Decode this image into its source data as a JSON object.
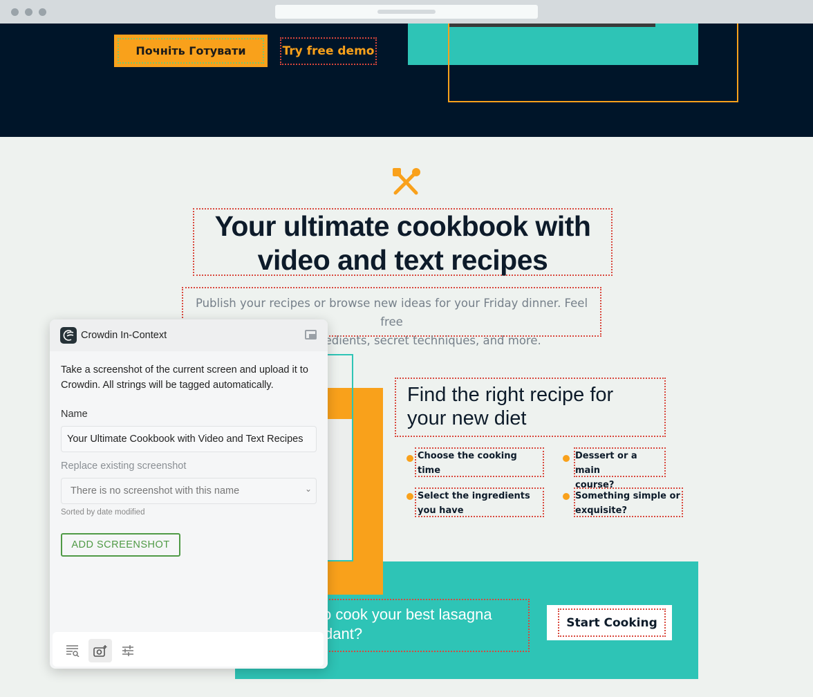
{
  "hero": {
    "primary_button": "Почніть Готувати",
    "secondary_button": "Try free demo"
  },
  "intro": {
    "title_line1": "Your ultimate cookbook with",
    "title_line2": "video and text recipes",
    "paragraph_line1": "Publish your recipes or browse new ideas for your Friday dinner. Feel free",
    "paragraph_line2": "to discuss ingredients, secret techniques, and more."
  },
  "features": {
    "title_line1": "Find the right recipe for",
    "title_line2": "your new diet",
    "items": [
      {
        "line1": "Choose the cooking time",
        "line2": ""
      },
      {
        "line1": "Dessert or a main",
        "line2": "course?"
      },
      {
        "line1": "Select the ingredients",
        "line2": "you have"
      },
      {
        "line1": "Something simple or",
        "line2": "exquisite?"
      }
    ]
  },
  "cta": {
    "line1": "o cook your best lasagna",
    "line2": "dant?",
    "button": "Start Cooking"
  },
  "panel": {
    "title": "Crowdin In-Context",
    "description": "Take a screenshot of the current screen and upload it to Crowdin. All strings will be tagged automatically.",
    "name_label": "Name",
    "name_value": "Your Ultimate Cookbook with Video and Text Recipes",
    "replace_label": "Replace existing screenshot",
    "replace_value": "There is no screenshot with this name",
    "hint": "Sorted by date modified",
    "add_button": "ADD SCREENSHOT"
  },
  "colors": {
    "dark": "#001529",
    "orange": "#f9a11b",
    "teal": "#2ec4b6",
    "green": "#4f9a45"
  }
}
